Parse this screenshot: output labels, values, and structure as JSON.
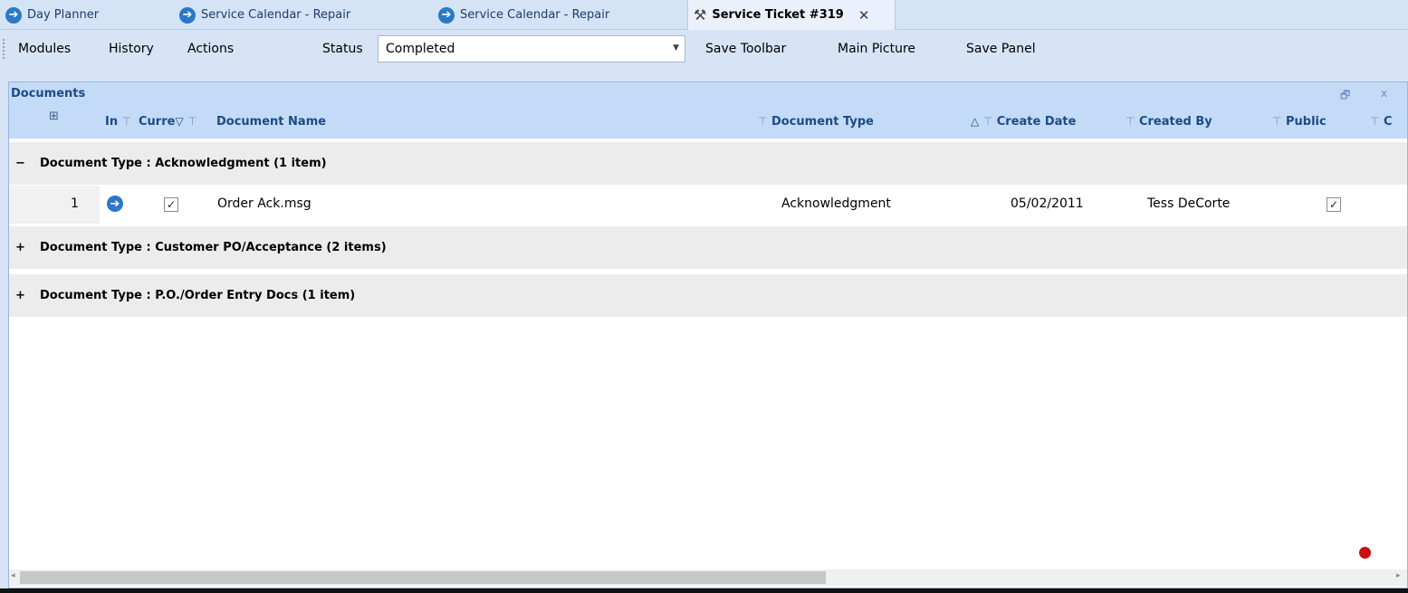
{
  "tabs": [
    {
      "label": "Day Planner",
      "icon": "arrow-circle-icon"
    },
    {
      "label": "Service Calendar - Repair",
      "icon": "arrow-circle-icon"
    },
    {
      "label": "Service Calendar - Repair",
      "icon": "arrow-circle-icon"
    },
    {
      "label": "Service Ticket #319",
      "icon": "tools-icon",
      "active": true
    }
  ],
  "toolbar": {
    "modules": "Modules",
    "history": "History",
    "actions": "Actions",
    "status_label": "Status",
    "status_value": "Completed",
    "save_toolbar": "Save Toolbar",
    "main_picture": "Main Picture",
    "save_panel": "Save Panel"
  },
  "panel": {
    "title": "Documents",
    "columns": {
      "in": "In",
      "current": "Curre",
      "document_name": "Document Name",
      "document_type": "Document Type",
      "create_date": "Create Date",
      "created_by": "Created By",
      "public": "Public",
      "cut": "C"
    },
    "groups": [
      {
        "label": "Document Type : Acknowledgment (1 item)",
        "expander": "−"
      },
      {
        "label": "Document Type : Customer PO/Acceptance (2 items)",
        "expander": "+"
      },
      {
        "label": "Document Type : P.O./Order Entry Docs (1 item)",
        "expander": "+"
      }
    ],
    "rows": [
      {
        "index": "1",
        "current_checked": true,
        "document_name": "Order Ack.msg",
        "document_type": "Acknowledgment",
        "create_date": "05/02/2011",
        "created_by": "Tess DeCorte",
        "public_checked": true
      }
    ]
  },
  "glyphs": {
    "filter": "⊤",
    "sort_desc": "▽",
    "sort_asc": "△",
    "check": "✓",
    "close": "✕",
    "restore": "🗗",
    "panel_close": "x",
    "dropdown": "▼",
    "scroll_left": "◂",
    "scroll_right": "▸",
    "arrow_circle": "➔",
    "tools": "⚒",
    "column_chooser": "⊞"
  },
  "colors": {
    "accent": "#2a78c8",
    "header_bg": "#c3dbf7",
    "group_bg": "#ececec",
    "indicator": "#c90f0f"
  }
}
